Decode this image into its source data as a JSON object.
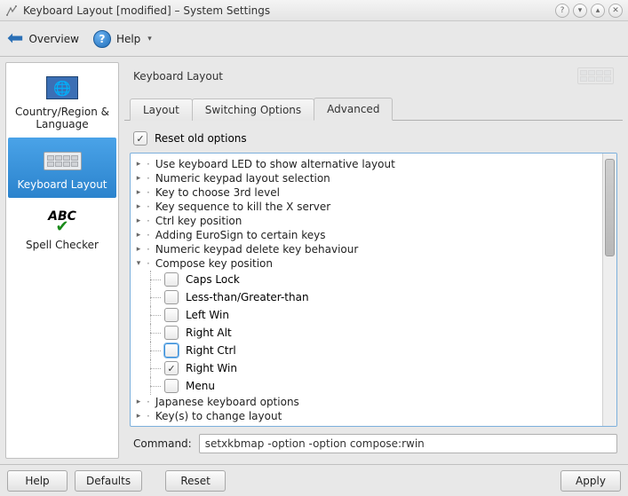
{
  "window": {
    "title": "Keyboard Layout [modified] – System Settings"
  },
  "toolbar": {
    "overview": "Overview",
    "help": "Help"
  },
  "sidebar": {
    "items": [
      {
        "label": "Country/Region & Language"
      },
      {
        "label": "Keyboard Layout"
      },
      {
        "label": "Spell Checker"
      }
    ]
  },
  "main": {
    "heading": "Keyboard Layout",
    "tabs": [
      {
        "label": "Layout"
      },
      {
        "label": "Switching Options"
      },
      {
        "label": "Advanced"
      }
    ],
    "reset_old": "Reset old options",
    "tree": {
      "collapsed": [
        "Use keyboard LED to show alternative layout",
        "Numeric keypad layout selection",
        "Key to choose 3rd level",
        "Key sequence to kill the X server",
        "Ctrl key position",
        "Adding EuroSign to certain keys",
        "Numeric keypad delete key behaviour"
      ],
      "expanded_label": "Compose key position",
      "compose_children": [
        {
          "label": "Caps Lock",
          "checked": false
        },
        {
          "label": "Less-than/Greater-than",
          "checked": false
        },
        {
          "label": "Left Win",
          "checked": false
        },
        {
          "label": "Right Alt",
          "checked": false
        },
        {
          "label": "Right Ctrl",
          "checked": false,
          "focus": true
        },
        {
          "label": "Right Win",
          "checked": true
        },
        {
          "label": "Menu",
          "checked": false
        }
      ],
      "tail": [
        "Japanese keyboard options",
        "Key(s) to change layout"
      ]
    },
    "command_label": "Command:",
    "command_value": "setxkbmap -option -option compose:rwin"
  },
  "footer": {
    "help": "Help",
    "defaults": "Defaults",
    "reset": "Reset",
    "apply": "Apply"
  }
}
